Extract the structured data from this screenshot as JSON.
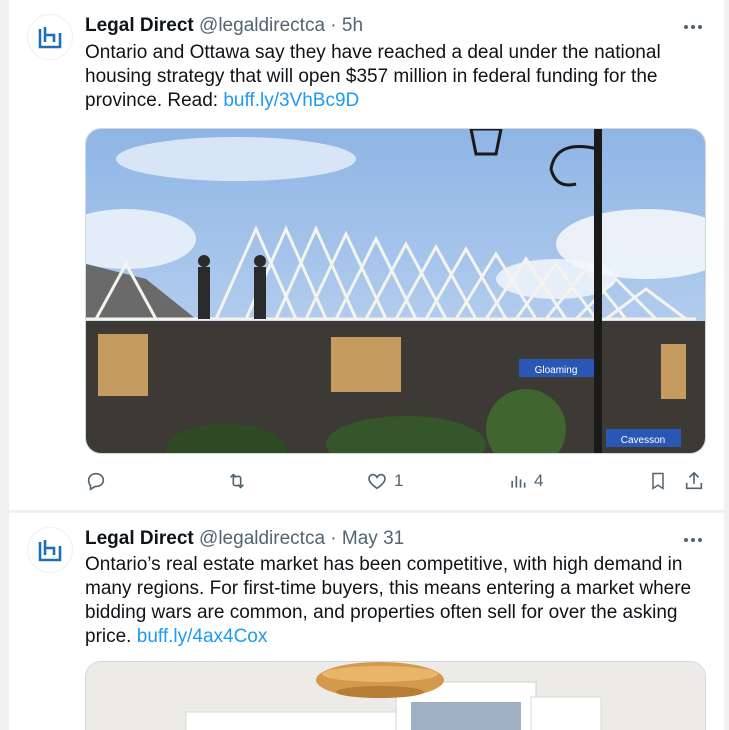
{
  "tweets": [
    {
      "author": "Legal Direct",
      "handle": "@legaldirectca",
      "separator": "·",
      "time": "5h",
      "text": "Ontario and Ottawa say they have reached a deal under the national housing strategy that will open $357 million in federal funding for the province. Read: ",
      "link": "buff.ly/3VhBc9D",
      "media_signs": [
        "Gloaming",
        "Cavesson"
      ],
      "likes": "1",
      "views": "4"
    },
    {
      "author": "Legal Direct",
      "handle": "@legaldirectca",
      "separator": "·",
      "time": "May 31",
      "text": "Ontario’s real estate market has been competitive, with high demand in many regions. For first-time buyers, this means entering a market where bidding wars are common, and properties often sell for over the asking price. ",
      "link": "buff.ly/4ax4Cox"
    }
  ],
  "icons": {
    "avatar": "legal-direct-logo",
    "more": "more-horizontal-icon",
    "reply": "reply-icon",
    "repost": "repost-icon",
    "like": "heart-icon",
    "views": "views-icon",
    "bookmark": "bookmark-icon",
    "share": "share-icon"
  },
  "colors": {
    "link": "#1d9bf0",
    "muted": "#536471",
    "logo": "#1d6fb8",
    "sky": "#a9c6ea"
  }
}
